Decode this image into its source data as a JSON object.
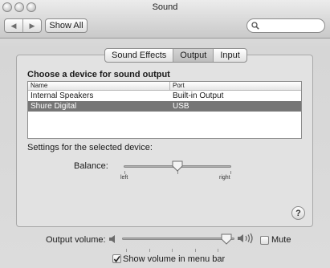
{
  "window": {
    "title": "Sound"
  },
  "toolbar": {
    "back_icon": "left-arrow-icon",
    "forward_icon": "right-arrow-icon",
    "show_all_label": "Show All",
    "search": {
      "value": "",
      "placeholder": ""
    }
  },
  "tabs": [
    {
      "label": "Sound Effects",
      "active": false
    },
    {
      "label": "Output",
      "active": true
    },
    {
      "label": "Input",
      "active": false
    }
  ],
  "output": {
    "heading": "Choose a device for sound output",
    "columns": [
      "Name",
      "Port"
    ],
    "devices": [
      {
        "name": "Internal Speakers",
        "port": "Built-in Output",
        "selected": false
      },
      {
        "name": "Shure Digital",
        "port": "USB",
        "selected": true
      }
    ],
    "settings_label": "Settings for the selected device:",
    "balance": {
      "label": "Balance:",
      "left_label": "left",
      "right_label": "right",
      "value": 0.5
    }
  },
  "bottom": {
    "volume_label": "Output volume:",
    "volume_level": 0.93,
    "mute_label": "Mute",
    "mute_checked": false,
    "menu_bar_label": "Show volume in menu bar",
    "menu_bar_checked": true
  },
  "colors": {
    "selected_row": "#767676",
    "window_bg": "#d9d9d9"
  }
}
